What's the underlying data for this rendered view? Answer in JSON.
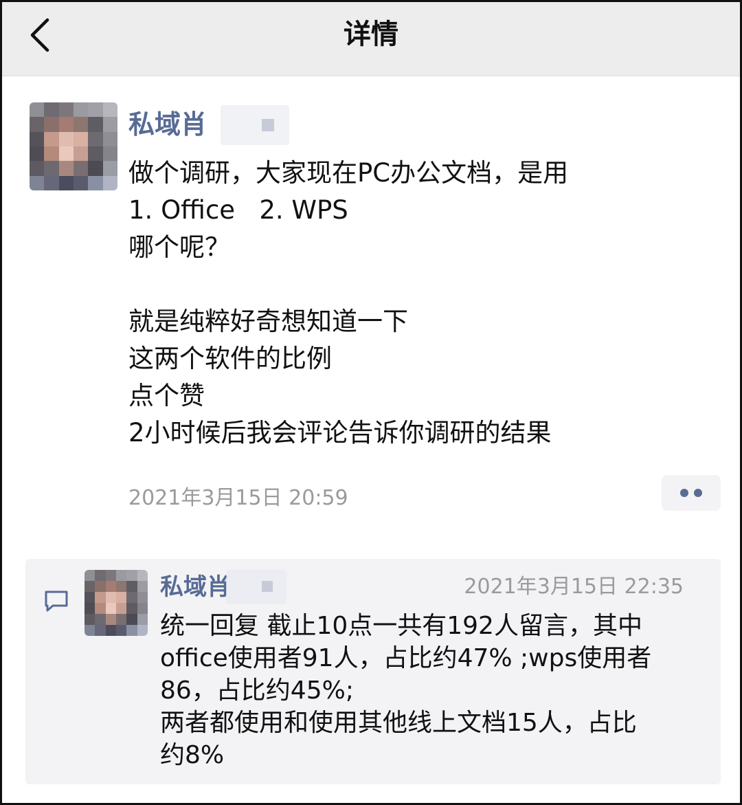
{
  "header": {
    "title": "详情"
  },
  "post": {
    "author": "私域肖",
    "lines": [
      "做个调研，大家现在PC办公文档，是用",
      "1. Office   2. WPS",
      "哪个呢？",
      "",
      "就是纯粹好奇想知道一下",
      "这两个软件的比例",
      "点个赞",
      "2小时候后我会评论告诉你调研的结果"
    ],
    "time": "2021年3月15日 20:59"
  },
  "comment": {
    "author": "私域肖",
    "time": "2021年3月15日 22:35",
    "lines": [
      "统一回复 截止10点一共有192人留言，其中",
      "office使用者91人，占比约47% ;wps使用者",
      "86，占比约45%;",
      "两者都使用和使用其他线上文档15人，占比",
      "约8%"
    ]
  },
  "colors": {
    "link_name": "#576b95",
    "nav_bg": "#ededed",
    "comment_bg": "#f3f3f5",
    "time_gray": "#9a9a9a"
  },
  "icons": {
    "back": "chevron-left-icon",
    "more": "more-dots-icon",
    "comment": "comment-bubble-icon"
  }
}
